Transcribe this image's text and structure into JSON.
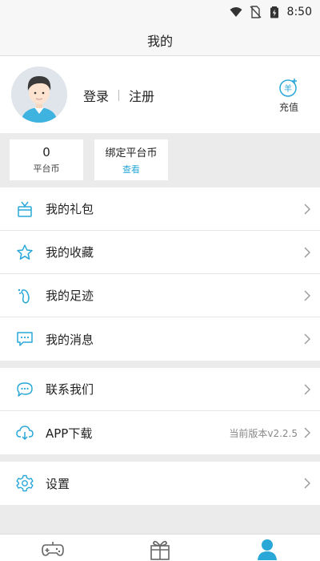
{
  "status_bar": {
    "time": "8:50",
    "icons": [
      "wifi-icon",
      "sim-off-icon",
      "battery-charging-icon"
    ]
  },
  "header": {
    "title": "我的"
  },
  "profile": {
    "avatar": "avatar-icon",
    "login_label": "登录",
    "register_label": "注册",
    "recharge_label": "充值",
    "recharge_icon_text": "羊"
  },
  "coins": {
    "platform_coin_value": "0",
    "platform_coin_label": "平台币",
    "bound_coin_title": "绑定平台币",
    "bound_coin_action": "查看"
  },
  "menu_groups": [
    {
      "items": [
        {
          "label": "我的礼包",
          "icon": "gift-bag-icon"
        },
        {
          "label": "我的收藏",
          "icon": "star-icon"
        },
        {
          "label": "我的足迹",
          "icon": "footprint-icon"
        },
        {
          "label": "我的消息",
          "icon": "message-icon"
        }
      ]
    },
    {
      "items": [
        {
          "label": "联系我们",
          "icon": "chat-bubble-icon"
        },
        {
          "label": "APP下载",
          "icon": "cloud-download-icon",
          "extra": "当前版本v2.2.5"
        }
      ]
    },
    {
      "items": [
        {
          "label": "设置",
          "icon": "settings-gear-icon"
        }
      ]
    }
  ],
  "tabbar": {
    "tabs": [
      "gamepad-icon",
      "gift-box-icon",
      "user-icon"
    ],
    "active_index": 2
  },
  "colors": {
    "accent": "#29a8d8",
    "background": "#ebebeb",
    "surface": "#ffffff",
    "tab_inactive": "#666666"
  }
}
